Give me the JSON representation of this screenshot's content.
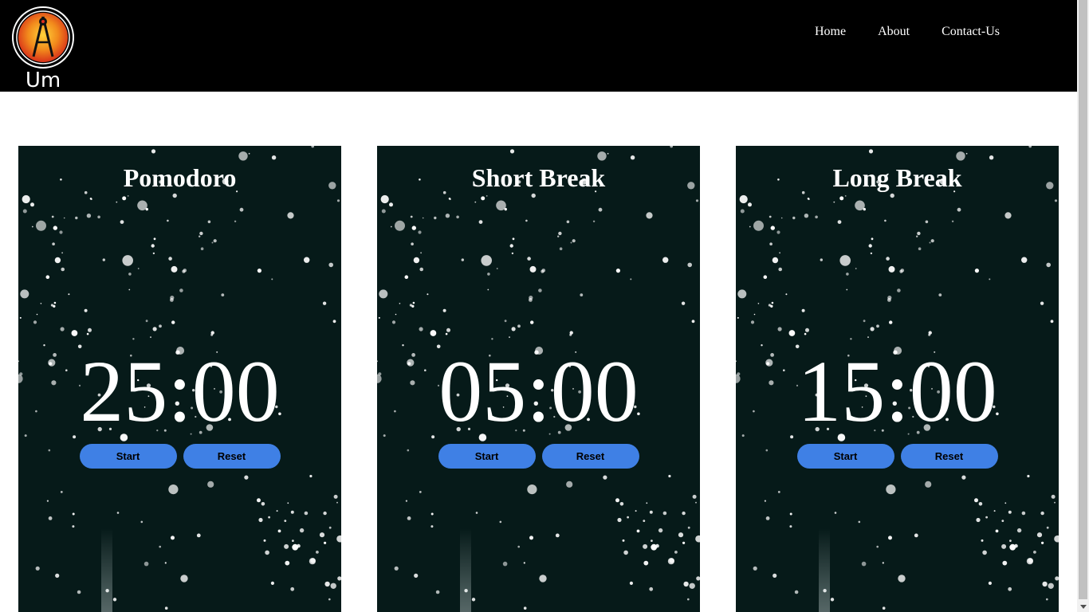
{
  "header": {
    "logo_name": "Um",
    "nav": [
      {
        "label": "Home"
      },
      {
        "label": "About"
      },
      {
        "label": "Contact-Us"
      }
    ]
  },
  "cards": [
    {
      "title": "Pomodoro",
      "time": "25:00",
      "start_label": "Start",
      "reset_label": "Reset"
    },
    {
      "title": "Short Break",
      "time": "05:00",
      "start_label": "Start",
      "reset_label": "Reset"
    },
    {
      "title": "Long Break",
      "time": "15:00",
      "start_label": "Start",
      "reset_label": "Reset"
    }
  ],
  "colors": {
    "header_bg": "#000000",
    "card_bg": "#061a19",
    "button_bg": "#3f80e5",
    "text": "#ffffff"
  }
}
